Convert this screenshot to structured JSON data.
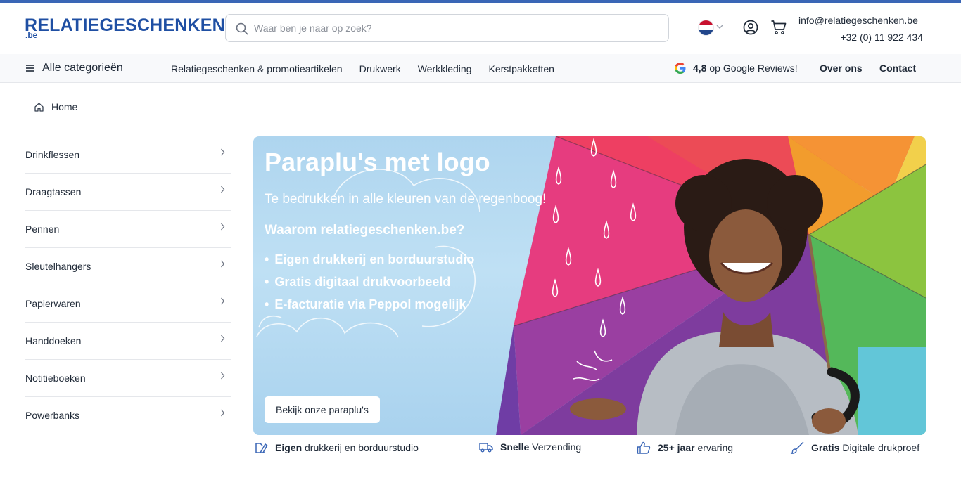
{
  "brand": {
    "name": "RELATIEGESCHENKEN",
    "suffix": ".be",
    "color": "#1f4fa3"
  },
  "search": {
    "placeholder": "Waar ben je naar op zoek?",
    "icon": "search-icon"
  },
  "header": {
    "language_flag": "flag-nl-icon",
    "email": "info@relatiegeschenken.be",
    "phone": "+32 (0) 11 922 434"
  },
  "nav": {
    "all_categories": "Alle categorieën",
    "links": [
      "Relatiegeschenken & promotieartikelen",
      "Drukwerk",
      "Werkkleding",
      "Kerstpakketten"
    ],
    "rating": "4,8",
    "rating_text": "op Google Reviews!",
    "about": "Over ons",
    "contact": "Contact"
  },
  "breadcrumb": {
    "home": "Home"
  },
  "sidebar": {
    "items": [
      {
        "label": "Drinkflessen"
      },
      {
        "label": "Draagtassen"
      },
      {
        "label": "Pennen"
      },
      {
        "label": "Sleutelhangers"
      },
      {
        "label": "Papierwaren"
      },
      {
        "label": "Handdoeken"
      },
      {
        "label": "Notitieboeken"
      },
      {
        "label": "Powerbanks"
      }
    ]
  },
  "hero": {
    "title": "Paraplu's met logo",
    "subtitle": "Te bedrukken in alle kleuren van de regenboog!",
    "why_heading": "Waarom relatiegeschenken.be?",
    "bullets": [
      "Eigen drukkerij en borduurstudio",
      "Gratis digitaal drukvoorbeeld",
      "E-facturatie via Peppol mogelijk"
    ],
    "button": "Bekijk onze paraplu's"
  },
  "features": [
    {
      "bold": "Eigen",
      "text": " drukkerij en borduurstudio",
      "icon": "print-icon"
    },
    {
      "bold": "Snelle",
      "text": " Verzending",
      "icon": "truck-icon"
    },
    {
      "bold": "25+ jaar",
      "text": " ervaring",
      "icon": "thumbs-up-icon"
    },
    {
      "bold": "Gratis",
      "text": " Digitale drukproef",
      "icon": "brush-icon"
    }
  ],
  "colors": {
    "accent": "#3a66b6",
    "hero_sky": "#aed5ef",
    "text": "#1f2937"
  }
}
